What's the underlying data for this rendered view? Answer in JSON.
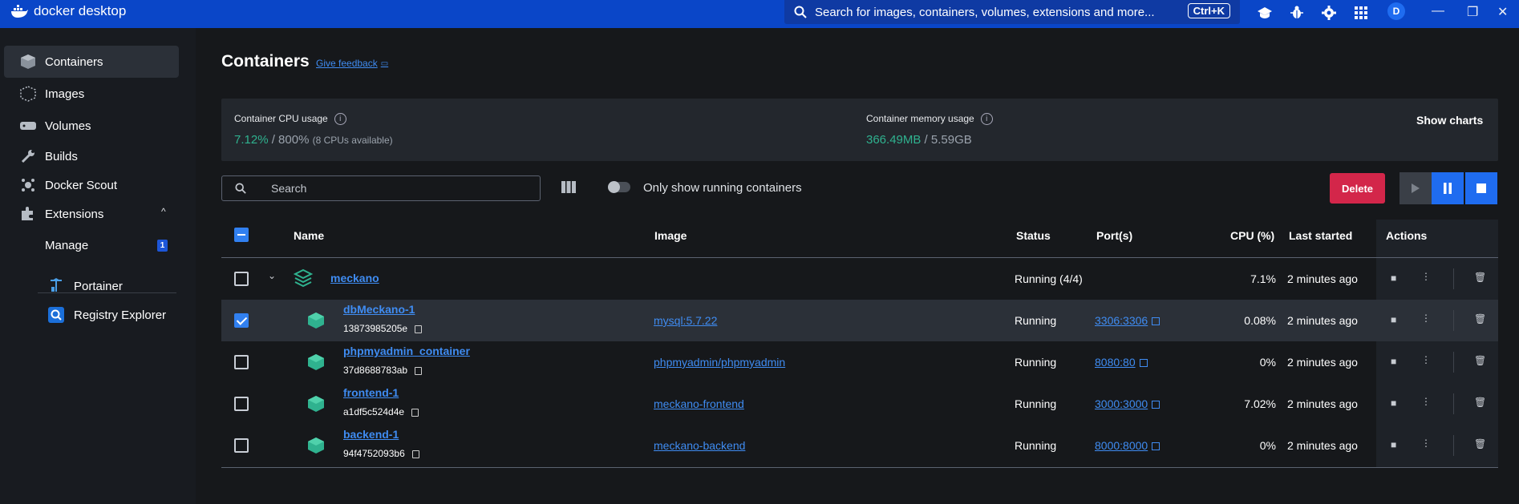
{
  "app": {
    "title": "docker desktop"
  },
  "topbar": {
    "search_placeholder": "Search for images, containers, volumes, extensions and more...",
    "shortcut": "Ctrl+K",
    "avatar_initial": "D"
  },
  "sidebar": {
    "items": [
      {
        "label": "Containers",
        "icon": "containers-icon",
        "active": true
      },
      {
        "label": "Images",
        "icon": "images-icon"
      },
      {
        "label": "Volumes",
        "icon": "volumes-icon"
      },
      {
        "label": "Builds",
        "icon": "builds-icon"
      },
      {
        "label": "Docker Scout",
        "icon": "scout-icon"
      },
      {
        "label": "Extensions",
        "icon": "extensions-icon"
      }
    ],
    "manage": {
      "label": "Manage",
      "badge": "1"
    },
    "extensions": [
      {
        "label": "Portainer",
        "icon": "portainer-icon"
      },
      {
        "label": "Registry Explorer",
        "icon": "registry-explorer-icon"
      }
    ]
  },
  "page": {
    "title": "Containers",
    "feedback": "Give feedback"
  },
  "stats": {
    "cpu_label": "Container CPU usage",
    "cpu_value": "7.12%",
    "cpu_total": " / 800%",
    "cpu_note": "(8 CPUs available)",
    "mem_label": "Container memory usage",
    "mem_value": "366.49MB",
    "mem_total": " / 5.59GB",
    "show_charts": "Show charts"
  },
  "toolbar": {
    "search_placeholder": "Search",
    "toggle_label": "Only show running containers",
    "delete": "Delete"
  },
  "table": {
    "headers": {
      "name": "Name",
      "image": "Image",
      "status": "Status",
      "ports": "Port(s)",
      "cpu": "CPU (%)",
      "last_started": "Last started",
      "actions": "Actions"
    },
    "group": {
      "name": "meckano",
      "status": "Running (4/4)",
      "cpu": "7.1%",
      "last_started": "2 minutes ago"
    },
    "rows": [
      {
        "name": "dbMeckano-1",
        "id": "13873985205e",
        "image": "mysql:5.7.22",
        "status": "Running",
        "ports": "3306:3306",
        "cpu": "0.08%",
        "last_started": "2 minutes ago",
        "checked": true
      },
      {
        "name": "phpmyadmin_container",
        "id": "37d8688783ab",
        "image": "phpmyadmin/phpmyadmin",
        "status": "Running",
        "ports": "8080:80",
        "cpu": "0%",
        "last_started": "2 minutes ago",
        "checked": false
      },
      {
        "name": "frontend-1",
        "id": "a1df5c524d4e",
        "image": "meckano-frontend",
        "status": "Running",
        "ports": "3000:3000",
        "cpu": "7.02%",
        "last_started": "2 minutes ago",
        "checked": false
      },
      {
        "name": "backend-1",
        "id": "94f4752093b6",
        "image": "meckano-backend",
        "status": "Running",
        "ports": "8000:8000",
        "cpu": "0%",
        "last_started": "2 minutes ago",
        "checked": false
      }
    ]
  },
  "colors": {
    "accent": "#0a46c8",
    "green": "#2fb28f",
    "link": "#3f8cf2",
    "danger": "#d3264a"
  }
}
